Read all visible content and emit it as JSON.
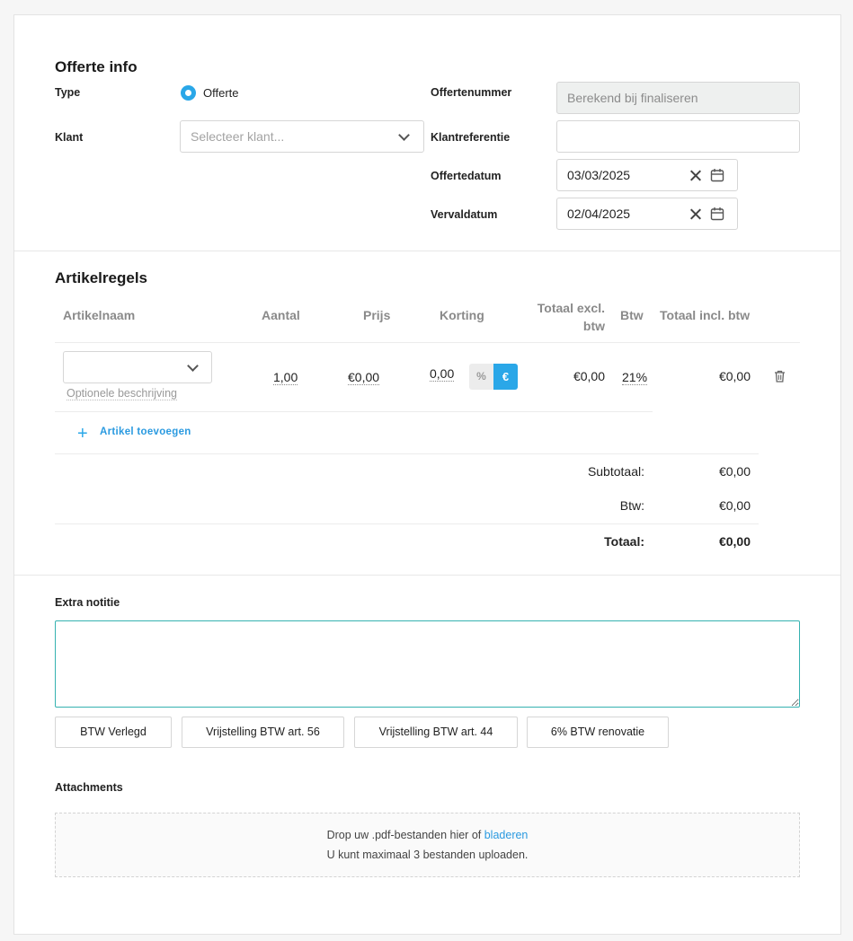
{
  "offer_info": {
    "title": "Offerte info",
    "type_label": "Type",
    "type_option": "Offerte",
    "client_label": "Klant",
    "client_placeholder": "Selecteer klant...",
    "offer_number_label": "Offertenummer",
    "offer_number_placeholder": "Berekend bij finaliseren",
    "client_ref_label": "Klantreferentie",
    "client_ref_value": "",
    "offer_date_label": "Offertedatum",
    "offer_date_value": "03/03/2025",
    "expiry_date_label": "Vervaldatum",
    "expiry_date_value": "02/04/2025"
  },
  "lines": {
    "title": "Artikelregels",
    "headers": {
      "name": "Artikelnaam",
      "qty": "Aantal",
      "price": "Prijs",
      "discount": "Korting",
      "total_excl_1": "Totaal excl.",
      "total_excl_2": "btw",
      "vat": "Btw",
      "total_incl": "Totaal incl. btw"
    },
    "row": {
      "description_placeholder": "Optionele beschrijving",
      "qty": "1,00",
      "price": "€0,00",
      "discount": "0,00",
      "discount_pct_symbol": "%",
      "discount_eur_symbol": "€",
      "total_excl": "€0,00",
      "vat": "21%",
      "total_incl": "€0,00"
    },
    "add_label": "Artikel toevoegen",
    "subtotal_label": "Subtotaal:",
    "subtotal_value": "€0,00",
    "vat_label": "Btw:",
    "vat_value": "€0,00",
    "total_label": "Totaal:",
    "total_value": "€0,00"
  },
  "notes": {
    "label": "Extra notitie",
    "value": "",
    "quick_buttons": [
      "BTW Verlegd",
      "Vrijstelling BTW art. 56",
      "Vrijstelling BTW art. 44",
      "6% BTW renovatie"
    ]
  },
  "attachments": {
    "label": "Attachments",
    "drop_text": "Drop uw .pdf-bestanden hier of",
    "browse_link": "bladeren",
    "limit_text": "U kunt maximaal 3 bestanden uploaden."
  },
  "colors": {
    "accent": "#2aa7e8",
    "focus_border": "#35b2b0"
  }
}
